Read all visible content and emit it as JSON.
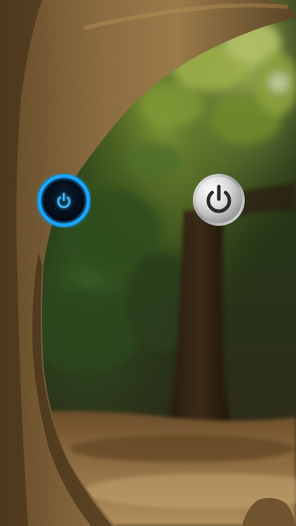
{
  "screen": {
    "description_free": true
  },
  "buttons": {
    "blue_power": {
      "icon": "power-icon",
      "state": "on",
      "accent_color": "#1aa6ff"
    },
    "silver_power": {
      "icon": "power-icon",
      "state": "off",
      "accent_color": "#c9c9c9"
    }
  }
}
